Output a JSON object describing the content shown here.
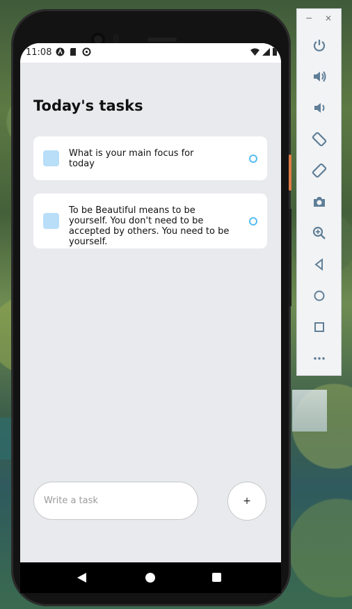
{
  "status_bar": {
    "time": "11:08",
    "left_icons": [
      "a-badge-icon",
      "sd-card-icon",
      "sync-icon"
    ],
    "right_icons": [
      "wifi-icon",
      "signal-icon",
      "battery-icon"
    ]
  },
  "app": {
    "title": "Today's tasks",
    "tasks": [
      {
        "text": "What is your main focus for today"
      },
      {
        "text": "To be Beautiful means to be yourself. You don't need to be accepted by others. You need to be yourself."
      }
    ],
    "input": {
      "placeholder": "Write a task",
      "value": ""
    },
    "add_button": {
      "label": "+"
    }
  },
  "emulator_toolbar": {
    "window_controls": [
      "−",
      "×"
    ],
    "buttons": [
      "power-icon",
      "volume-up-icon",
      "volume-down-icon",
      "rotate-left-icon",
      "rotate-right-icon",
      "camera-icon",
      "zoom-icon",
      "back-icon",
      "home-icon",
      "overview-icon",
      "more-icon"
    ]
  },
  "colors": {
    "accent": "#55bcf2",
    "task_square": "#b9def8",
    "screen_bg": "#e8eaed",
    "toolbar_icon": "#5f7e97"
  }
}
